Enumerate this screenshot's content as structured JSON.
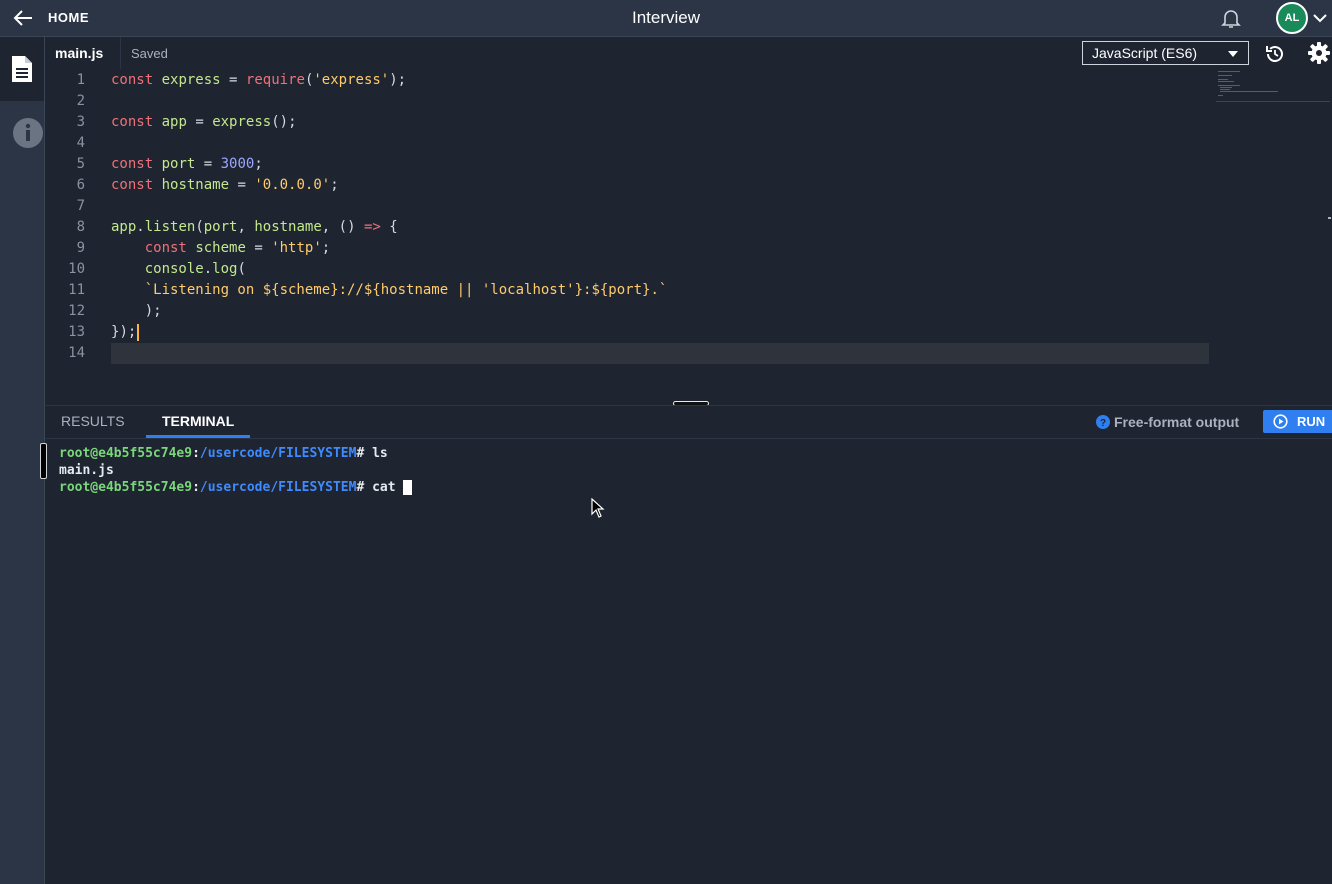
{
  "header": {
    "home_label": "HOME",
    "title": "Interview",
    "avatar_initials": "AL"
  },
  "editor": {
    "file_name": "main.js",
    "save_status": "Saved",
    "language": "JavaScript (ES6)",
    "line_numbers": [
      "1",
      "2",
      "3",
      "4",
      "5",
      "6",
      "7",
      "8",
      "9",
      "10",
      "11",
      "12",
      "13",
      "14"
    ],
    "lines": [
      "const express = require('express');",
      "",
      "const app = express();",
      "",
      "const port = 3000;",
      "const hostname = '0.0.0.0';",
      "",
      "app.listen(port, hostname, () => {",
      "    const scheme = 'http';",
      "    console.log(",
      "    `Listening on ${scheme}://${hostname || 'localhost'}:${port}.`",
      "    );",
      "});",
      ""
    ]
  },
  "panel": {
    "tabs": [
      {
        "label": "RESULTS",
        "active": false
      },
      {
        "label": "TERMINAL",
        "active": true
      }
    ],
    "free_format_label": "Free-format output",
    "run_label": "RUN"
  },
  "terminal": {
    "prompt_user": "root@e4b5f55c74e9",
    "prompt_path": "/usercode/FILESYSTEM",
    "lines": [
      {
        "command": "ls"
      },
      {
        "output": "main.js"
      },
      {
        "command": "cat "
      }
    ]
  },
  "colors": {
    "accent": "#2f7ff0",
    "avatar": "#1a8a5a",
    "keyword": "#f07178",
    "string": "#ffcb6b",
    "prompt_user": "#7ad77a",
    "prompt_path": "#3e8bff"
  },
  "icons": [
    "arrow-left-icon",
    "bell-icon",
    "chevron-down-icon",
    "file-icon",
    "info-icon",
    "history-icon",
    "gear-icon",
    "help-icon",
    "play-icon"
  ]
}
